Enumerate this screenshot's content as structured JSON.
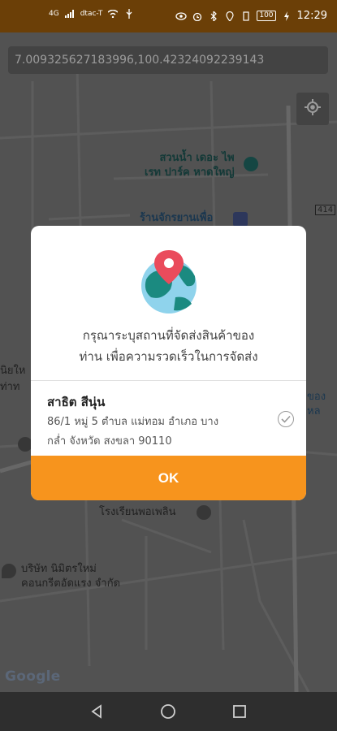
{
  "status_bar": {
    "left_labels": [
      "4G",
      "dtac-T"
    ],
    "battery": "100",
    "time": "12:29"
  },
  "map": {
    "coordinates": "7.009325627183996,100.42324092239143",
    "places": [
      {
        "line1": "สวนน้ำ เดอะ ไพ",
        "line2": "เรท ปาร์ค หาดใหญ่"
      },
      {
        "line1": "ร้านจักรยานเพื่อ"
      },
      {
        "line1": "โรงเรียนพอเพลิน"
      },
      {
        "line1": "บริษัท นิมิตรใหม่",
        "line2": "คอนกรีตอัดแรง จำกัด"
      }
    ],
    "route_badge": "414",
    "side_text_left": [
      "นิยให",
      "ท่าท"
    ],
    "side_text_right": "ของหล",
    "attribution": "Google"
  },
  "dialog": {
    "message_line1": "กรุณาระบุสถานที่จัดส่งสินค้าของ",
    "message_line2": "ท่าน เพื่อความรวดเร็วในการจัดส่ง",
    "address_name": "สาธิต สีนุ่น",
    "address_line1": "86/1  หมู่ 5 ตำบล แม่ทอม อำเภอ บาง",
    "address_line2": "กล่ำ จังหวัด สงขลา 90110",
    "ok_label": "OK"
  },
  "colors": {
    "accent": "#f7941d",
    "status_bar": "#6b3f07",
    "map": "#6e6e6e"
  },
  "icons": [
    "my-location-icon",
    "check-circle-icon",
    "back-icon",
    "home-icon",
    "recents-icon"
  ]
}
